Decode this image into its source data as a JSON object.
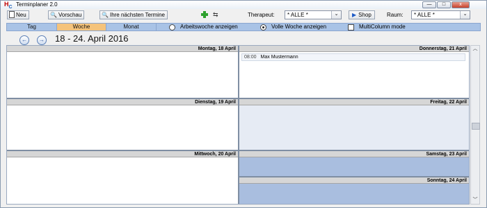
{
  "window": {
    "title": "Terminplaner 2.0",
    "logo": "H",
    "logo_sub": "C",
    "controls": {
      "minimize": "—",
      "maximize": "□",
      "close": "x"
    }
  },
  "toolbar": {
    "neu_label": "Neu",
    "vorschau_label": "Vorschau",
    "termine_label": "Ihre nächsten Termine",
    "therapeut_label": "Therapeut:",
    "therapeut_value": "* ALLE *",
    "shop_label": "Shop",
    "raum_label": "Raum:",
    "raum_value": "* ALLE *"
  },
  "viewbar": {
    "tabs": [
      {
        "label": "Tag"
      },
      {
        "label": "Woche"
      },
      {
        "label": "Monat"
      }
    ],
    "active_tab": "Woche",
    "arbeitswoche_label": "Arbeitswoche anzeigen",
    "volle_woche_label": "Volle Woche anzeigen",
    "selected_option": "Volle Woche anzeigen",
    "multicolumn_label": "MultiColumn mode",
    "multicolumn_checked": false
  },
  "week": {
    "title": "18 - 24. April 2016"
  },
  "days": [
    {
      "label": "Montag, 18 April"
    },
    {
      "label": "Donnerstag, 21 April"
    },
    {
      "label": "Dienstag, 19 April"
    },
    {
      "label": "Freitag, 22 April"
    },
    {
      "label": "Mittwoch, 20 April"
    },
    {
      "label": "Samstag, 23 April"
    },
    {
      "label": "Sonntag, 24 April"
    }
  ],
  "appointments": [
    {
      "time": "08:00",
      "name": "Max Mustermann"
    }
  ],
  "colors": {
    "active_tab": "#f5c37b",
    "viewbar": "#a9c3e6",
    "weekend": "#a9bedf",
    "header": "#d6d6d6"
  }
}
